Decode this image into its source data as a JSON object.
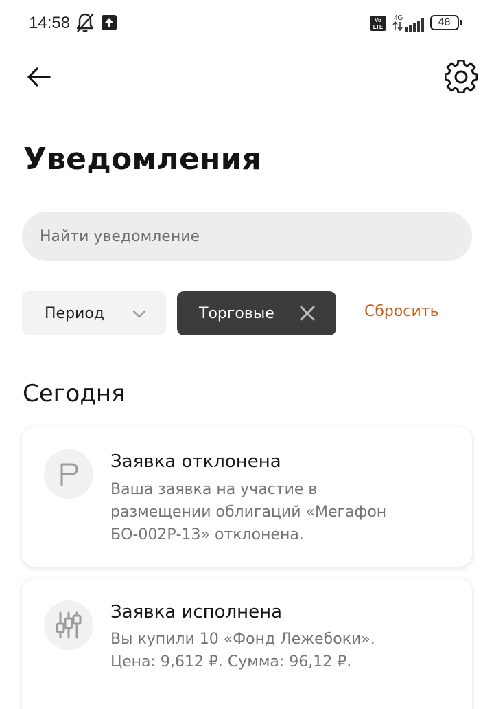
{
  "status_bar": {
    "time": "14:58",
    "network": "4G",
    "volte": "Vo LTE",
    "battery": "48"
  },
  "header": {
    "title": "Уведомления"
  },
  "search": {
    "placeholder": "Найти уведомление"
  },
  "filters": {
    "period_label": "Период",
    "trade_label": "Торговые",
    "reset_label": "Сбросить"
  },
  "colors": {
    "accent": "#c9601a",
    "chip_active": "#3c3c3c"
  },
  "section": {
    "title": "Сегодня"
  },
  "notifications": [
    {
      "icon": "flag-icon",
      "title": "Заявка отклонена",
      "lines": [
        "Ваша заявка на участие в",
        "размещении облигаций «Мегафон",
        "БО-002Р-13» отклонена."
      ]
    },
    {
      "icon": "sliders-icon",
      "title": "Заявка исполнена",
      "lines": [
        "Вы купили 10 «Фонд Лежебоки».",
        "Цена: 9,612 ₽. Сумма: 96,12 ₽."
      ]
    }
  ]
}
